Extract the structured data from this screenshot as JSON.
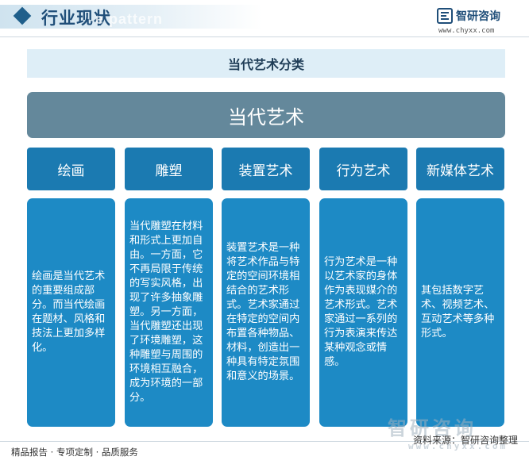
{
  "header": {
    "title": "行业现状",
    "watermark": "e pattern"
  },
  "brand": {
    "name": "智研咨询",
    "url": "www.chyxx.com"
  },
  "subtitle": "当代艺术分类",
  "root": "当代艺术",
  "categories": [
    {
      "title": "绘画",
      "text": "绘画是当代艺术的重要组成部分。而当代绘画在题材、风格和技法上更加多样化。"
    },
    {
      "title": "雕塑",
      "text": "当代雕塑在材料和形式上更加自由。一方面，它不再局限于传统的写实风格，出现了许多抽象雕塑。另一方面，当代雕塑还出现了环境雕塑，这种雕塑与周围的环境相互融合，成为环境的一部分。"
    },
    {
      "title": "装置艺术",
      "text": "装置艺术是一种将艺术作品与特定的空间环境相结合的艺术形式。艺术家通过在特定的空间内布置各种物品、材料，创造出一种具有特定氛围和意义的场景。"
    },
    {
      "title": "行为艺术",
      "text": "行为艺术是一种以艺术家的身体作为表现媒介的艺术形式。艺术家通过一系列的行为表演来传达某种观念或情感。"
    },
    {
      "title": "新媒体艺术",
      "text": "其包括数字艺术、视频艺术、互动艺术等多种形式。"
    }
  ],
  "footer": {
    "left": "精品报告 · 专项定制 · 品质服务",
    "source": "资料来源：智研咨询整理",
    "watermark": "智研咨询",
    "watermark_url": "www.chyxx.com"
  },
  "colors": {
    "root": "#64889b",
    "category_header": "#1b7ab1",
    "category_body": "#1d8ac5",
    "subtitle_band": "#deeef7",
    "title": "#1f4e79"
  }
}
